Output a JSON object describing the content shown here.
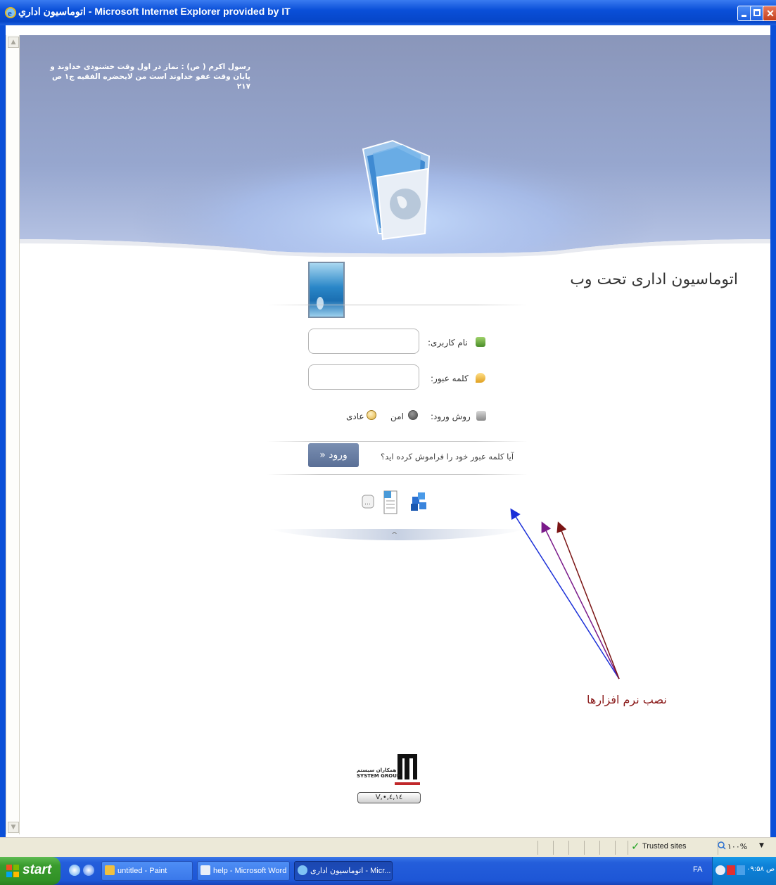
{
  "window": {
    "title": "اتوماسيون اداري - Microsoft Internet Explorer provided by IT"
  },
  "banner": {
    "quote_line1": "رسول اكرم ( ص) : نماز در اول وقت خشنودی خداوند و",
    "quote_line2": "پایان وقت عفو خداوند است من لایحضره الفقیه ج۱ ص ۲۱۷"
  },
  "login": {
    "app_title": "اتوماسیون اداری تحت وب",
    "username_label": "نام کاربری:",
    "username_value": "",
    "password_label": "کلمه عبور:",
    "password_value": "",
    "login_method_label": "روش ورود:",
    "option_secure": "امن",
    "option_normal": "عادی",
    "enter_button": "ورود «",
    "forgot_link": "آیا کلمه عبور خود را فراموش کرده اید؟",
    "collapse_caret": "^"
  },
  "annotation": {
    "text": "نصب نرم افزارها",
    "arrow_colors": [
      "#1a2fd8",
      "#7a1a8a",
      "#7a1414"
    ]
  },
  "footer": {
    "company_name_fa": "همکاران سیستم",
    "company_name_en": "SYSTEM GROUP",
    "version": "V,•,٤,١٤"
  },
  "statusbar": {
    "zone": "Trusted sites",
    "zoom": "١٠٠%"
  },
  "taskbar": {
    "start_label": "start",
    "tasks": [
      {
        "label": "untitled - Paint"
      },
      {
        "label": "help - Microsoft Word"
      },
      {
        "label": "اتوماسیون اداری - Micr..."
      }
    ],
    "language": "FA",
    "clock": "ص ۰۹:۵۸"
  },
  "colors": {
    "title_bar": "#0a4fd8",
    "banner_top": "#8e9cc0",
    "banner_glow": "#a8c8f8",
    "enter_button": "#6a7fa6",
    "annotation": "#8a1a1a"
  }
}
